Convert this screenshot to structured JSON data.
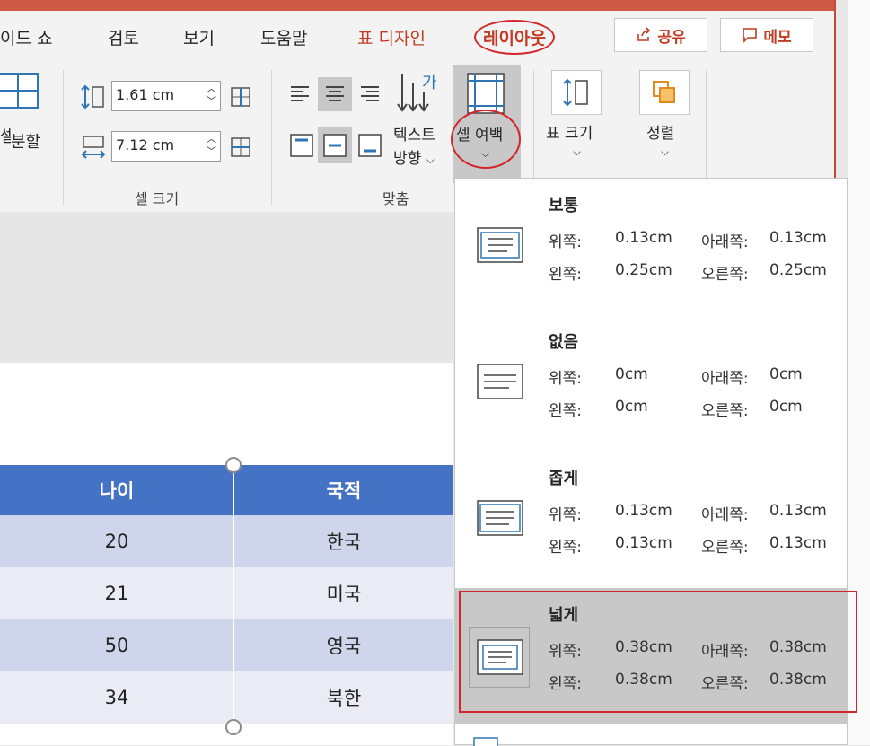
{
  "tabs": {
    "slideshow": "이드 쇼",
    "review": "검토",
    "view": "보기",
    "help": "도움말",
    "table_design": "표 디자인",
    "layout": "레이아웃"
  },
  "buttons": {
    "share": "공유",
    "memo": "메모"
  },
  "ribbon": {
    "split_cells": "분할",
    "height_value": "1.61 cm",
    "width_value": "7.12 cm",
    "cell_size_group": "셀 크기",
    "text_direction_line1": "텍스트",
    "text_direction_line2": "방향",
    "cell_margins": "셀 여백",
    "align_group": "맞춤",
    "table_size": "표 크기",
    "arrange": "정렬"
  },
  "table": {
    "headers": [
      "나이",
      "국적"
    ],
    "rows": [
      [
        "20",
        "한국"
      ],
      [
        "21",
        "미국"
      ],
      [
        "50",
        "영국"
      ],
      [
        "34",
        "북한"
      ]
    ]
  },
  "margin_options": [
    {
      "name": "보통",
      "top_label": "위쪽:",
      "top": "0.13cm",
      "bottom_label": "아래쪽:",
      "bottom": "0.13cm",
      "left_label": "왼쪽:",
      "left": "0.25cm",
      "right_label": "오른쪽:",
      "right": "0.25cm"
    },
    {
      "name": "없음",
      "top_label": "위쪽:",
      "top": "0cm",
      "bottom_label": "아래쪽:",
      "bottom": "0cm",
      "left_label": "왼쪽:",
      "left": "0cm",
      "right_label": "오른쪽:",
      "right": "0cm"
    },
    {
      "name": "좁게",
      "top_label": "위쪽:",
      "top": "0.13cm",
      "bottom_label": "아래쪽:",
      "bottom": "0.13cm",
      "left_label": "왼쪽:",
      "left": "0.13cm",
      "right_label": "오른쪽:",
      "right": "0.13cm"
    },
    {
      "name": "넓게",
      "top_label": "위쪽:",
      "top": "0.38cm",
      "bottom_label": "아래쪽:",
      "bottom": "0.38cm",
      "left_label": "왼쪽:",
      "left": "0.38cm",
      "right_label": "오른쪽:",
      "right": "0.38cm"
    }
  ],
  "colors": {
    "accent": "#c23b22",
    "highlight": "#d4262a",
    "table_header": "#4472c4",
    "icon_blue": "#2e75b6"
  }
}
